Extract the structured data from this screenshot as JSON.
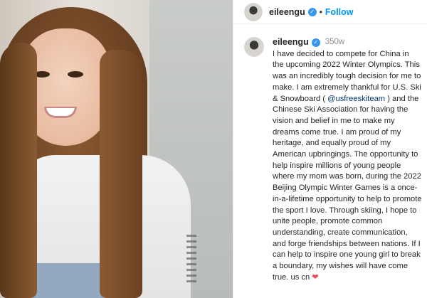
{
  "header": {
    "username": "eileengu",
    "separator": "•",
    "follow_label": "Follow"
  },
  "post": {
    "username": "eileengu",
    "time_ago": "350w",
    "caption_part1": "I have decided to compete for China in the upcoming 2022 Winter Olympics. This was an incredibly tough decision for me to make. I am extremely thankful for U.S. Ski & Snowboard ( ",
    "mention": "@usfreeskiteam",
    "caption_part2": " ) and the Chinese Ski Association for having the vision and belief in me to make my dreams come true. I am proud of my heritage, and equally proud of my American upbringings. The opportunity to help inspire millions of young people where my mom was born, during the 2022 Beijing Olympic Winter Games is a once-in-a-lifetime opportunity to help to promote the sport I love. Through skiing, I hope to unite people, promote common understanding, create communication, and forge friendships between nations. If I can help to inspire one young girl to break a boundary, my wishes will have come true. us cn ",
    "emoji": "❤"
  },
  "icons": {
    "verified": "verified-badge-icon",
    "heart": "heart-emoji-icon"
  },
  "colors": {
    "link": "#0095f6",
    "mention": "#00376b",
    "verified": "#3897f0",
    "heart": "#ed4956"
  }
}
